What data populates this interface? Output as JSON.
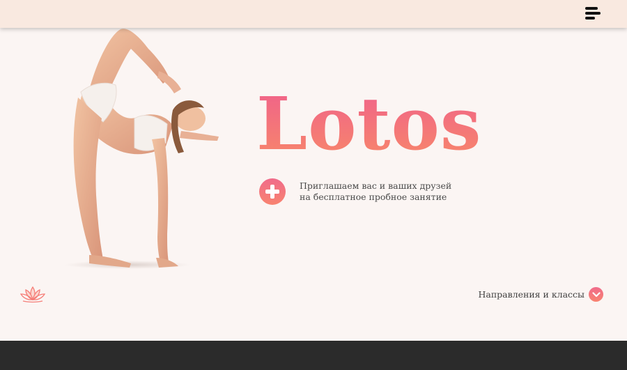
{
  "header": {
    "menu_icon": "hamburger-menu-icon"
  },
  "hero": {
    "brand": "Lotos",
    "brand_gradient": [
      "#f0628a",
      "#f7866b"
    ],
    "invite": {
      "icon": "plus-icon",
      "line1": "Приглашаем вас и ваших друзей",
      "line2": "на бесплатное пробное занятие"
    },
    "logo_icon": "lotus-icon",
    "classes_link": {
      "label": "Направления и классы",
      "icon": "chevron-down-icon"
    }
  },
  "colors": {
    "accent": "#f26e85",
    "background": "#fbf5f3",
    "topbar": "#f9e9e0",
    "footer": "#2b2b2b"
  }
}
